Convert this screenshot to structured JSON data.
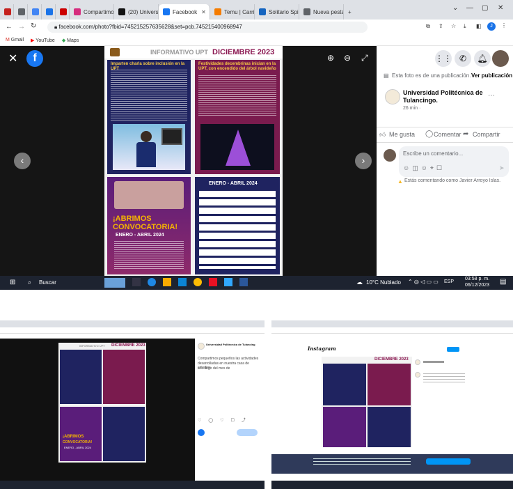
{
  "main": {
    "tabs": [
      {
        "label": "",
        "color": "#c5221f"
      },
      {
        "label": "",
        "color": "#5f6368"
      },
      {
        "label": "",
        "color": "#4285f4"
      },
      {
        "label": "",
        "color": "#1a73e8"
      },
      {
        "label": "",
        "color": "#c00"
      },
      {
        "label": "Compartimos",
        "color": "#d62d7e"
      },
      {
        "label": "(20) Universid",
        "color": "#111"
      },
      {
        "label": "Facebook",
        "color": "#1877f2"
      },
      {
        "label": "Temu | Carrito",
        "color": "#f57c00"
      },
      {
        "label": "Solitario Spide",
        "color": "#1565c0"
      },
      {
        "label": "Nueva pestaña",
        "color": "#5f6368"
      }
    ],
    "url": "facebook.com/photo?fbid=745215257635628&set=pcb.745215400968947",
    "bookmarks": [
      "Gmail",
      "YouTube",
      "Maps"
    ],
    "poster": {
      "header_left": "INFORMATIVO UPT",
      "header_right": "DICIEMBRE 2023",
      "left_title": "Imparten charla sobre inclusión en la UPT",
      "right_title": "Festividades decembrinas inician en la UPT, con encendido del árbol navideño",
      "bottom_left_1": "¡ABRIMOS",
      "bottom_left_2": "CONVOCATORIA!",
      "bottom_left_3": "ENERO - ABRIL 2024",
      "bottom_right_title": "ENERO - ABRIL 2024"
    },
    "fb": {
      "note": "Esta foto es de una publicación.",
      "view_post": "Ver publicación",
      "page_name": "Universidad Politécnica de Tulancingo.",
      "time": "26 min · ",
      "like": "Me gusta",
      "comment": "Comentar",
      "share": "Compartir",
      "comment_placeholder": "Escribe un comentario...",
      "commenting_as": "Estás comentando como Javier Arroyo Islas."
    },
    "taskbar": {
      "search": "Buscar",
      "weather": "10°C  Nublado",
      "lang": "ESP",
      "time": "03:58 p. m.",
      "date": "06/12/2023"
    }
  },
  "left_shot": {
    "header_left": "INFORMATIVO UPT",
    "header_right": "DICIEMBRE 2023",
    "page_name": "Universidad Politécnica de Tulancing",
    "caption_1": "Compartimos pequeños las actividades",
    "caption_2": "desarrolladas en nuestra casa de estudios",
    "caption_3": "a lo largo del mes de",
    "convocatoria_1": "¡ABRIMOS",
    "convocatoria_2": "CONVOCATORIA!",
    "enero": "ENERO - ABRIL 2024"
  },
  "right_shot": {
    "brand": "Instagram",
    "header_right": "DICIEMBRE 2023",
    "btn_primary": "",
    "btn_secondary": "",
    "banner_button": ""
  }
}
